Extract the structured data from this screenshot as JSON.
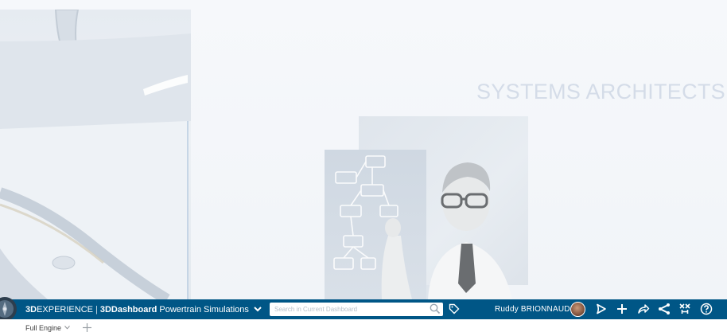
{
  "background": {
    "tagline": "SYSTEMS ARCHITECTS"
  },
  "topbar": {
    "brand_bold": "3D",
    "brand_light": "EXPERIENCE",
    "separator": "|",
    "app_bold": "3D",
    "app_name": "Dashboard",
    "dashboard_title": "Powertrain Simulations",
    "search_placeholder": "Search in Current Dashboard",
    "user_name": "Ruddy BRIONNAUD",
    "icons": [
      "compass-icon",
      "search-icon",
      "tag-icon",
      "avatar",
      "notifications-icon",
      "add-icon",
      "share-icon",
      "social-icon",
      "apps-icon",
      "help-icon"
    ],
    "bar_color": "#005686"
  },
  "tabs": [
    {
      "label": "Full Engine",
      "active": true
    }
  ]
}
